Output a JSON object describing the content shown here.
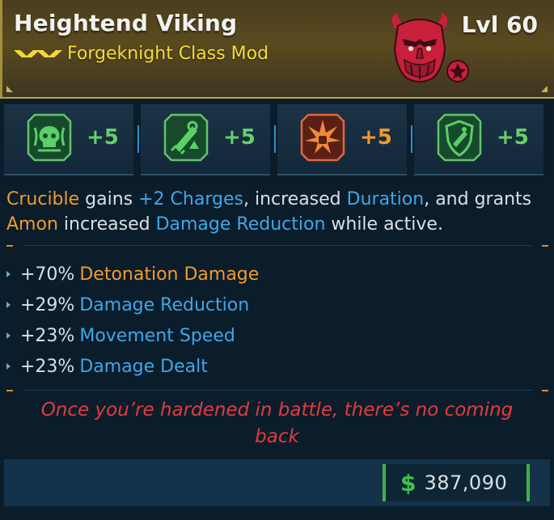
{
  "item": {
    "name": "Heightend Viking",
    "type": "Forgeknight Class Mod",
    "level": "Lvl 60",
    "rarity_color": "#f2d83a"
  },
  "skills": [
    {
      "icon": "skull-shield-icon",
      "bonus": "+5",
      "color": "#66d06b"
    },
    {
      "icon": "blade-sword-icon",
      "bonus": "+5",
      "color": "#66d06b"
    },
    {
      "icon": "fist-burst-icon",
      "bonus": "+5",
      "color": "#f29a2e"
    },
    {
      "icon": "shield-crest-icon",
      "bonus": "+5",
      "color": "#66d06b"
    }
  ],
  "description": {
    "s1": "Crucible",
    "s2": " gains ",
    "s3": "+2 Charges",
    "s4": ", increased ",
    "s5": "Duration",
    "s6": ", and grants ",
    "s7": "Amon",
    "s8": " increased ",
    "s9": "Damage Reduction",
    "s10": " while active."
  },
  "stats": [
    {
      "value": "+70%",
      "label": "Detonation Damage",
      "color": "#f29a2e"
    },
    {
      "value": "+29%",
      "label": "Damage Reduction",
      "color": "#3fa7e8"
    },
    {
      "value": "+23%",
      "label": "Movement Speed",
      "color": "#3fa7e8"
    },
    {
      "value": "+23%",
      "label": "Damage Dealt",
      "color": "#3fa7e8"
    }
  ],
  "flavor": "Once you’re hardened in battle, there’s no coming back",
  "price": {
    "currency_symbol": "$",
    "amount": "387,090"
  },
  "colors": {
    "orange": "#f29a2e",
    "blue": "#3fa7e8",
    "green": "#3fc24c",
    "red": "#e23b40",
    "gold": "#f5dc3a"
  }
}
